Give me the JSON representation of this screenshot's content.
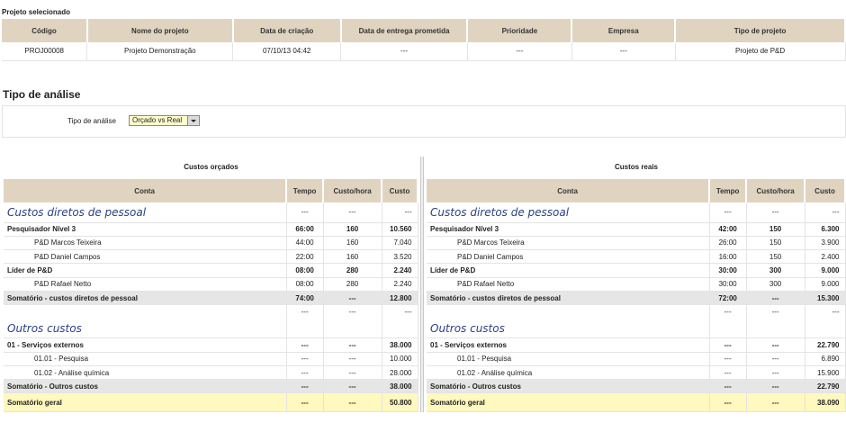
{
  "project": {
    "section_title": "Projeto selecionado",
    "headers": [
      "Código",
      "Nome do projeto",
      "Data de criação",
      "Data de entrega prometida",
      "Prioridade",
      "Empresa",
      "Tipo de projeto"
    ],
    "row": [
      "PROJ00008",
      "Projeto Demonstração",
      "07/10/13 04:42",
      "---",
      "---",
      "---",
      "Projeto de P&D"
    ]
  },
  "analysis": {
    "title": "Tipo de análise",
    "field_label": "Tipo de análise",
    "selected": "Orçado vs Real"
  },
  "budget": {
    "title": "Custos orçados",
    "headers": [
      "Conta",
      "Tempo",
      "Custo/hora",
      "Custo"
    ],
    "rows": [
      {
        "type": "cat",
        "cells": [
          "Custos diretos de pessoal",
          "---",
          "---",
          "---"
        ]
      },
      {
        "type": "bold",
        "cells": [
          "Pesquisador Nível 3",
          "66:00",
          "160",
          "10.560"
        ]
      },
      {
        "type": "child",
        "cells": [
          "P&D Marcos Teixeira",
          "44:00",
          "160",
          "7.040"
        ]
      },
      {
        "type": "child",
        "cells": [
          "P&D Daniel Campos",
          "22:00",
          "160",
          "3.520"
        ]
      },
      {
        "type": "bold",
        "cells": [
          "Líder de P&D",
          "08:00",
          "280",
          "2.240"
        ]
      },
      {
        "type": "child",
        "cells": [
          "P&D Rafael Netto",
          "08:00",
          "280",
          "2.240"
        ]
      },
      {
        "type": "subtotal",
        "cells": [
          "Somatório - custos diretos de pessoal",
          "74:00",
          "---",
          "12.800"
        ]
      },
      {
        "type": "gap",
        "cells": [
          "",
          "---",
          "---",
          "---"
        ]
      },
      {
        "type": "cat",
        "cells": [
          "Outros custos",
          "",
          "",
          ""
        ]
      },
      {
        "type": "bold",
        "cells": [
          "01 - Serviços externos",
          "---",
          "---",
          "38.000"
        ]
      },
      {
        "type": "child",
        "cells": [
          "01.01 - Pesquisa",
          "---",
          "---",
          "10.000"
        ]
      },
      {
        "type": "child",
        "cells": [
          "01.02 - Análise química",
          "---",
          "---",
          "28.000"
        ]
      },
      {
        "type": "subtotal",
        "cells": [
          "Somatório - Outros custos",
          "---",
          "---",
          "38.000"
        ]
      },
      {
        "type": "grand",
        "cells": [
          "Somatório geral",
          "---",
          "---",
          "50.800"
        ]
      }
    ]
  },
  "actual": {
    "title": "Custos reais",
    "headers": [
      "Conta",
      "Tempo",
      "Custo/hora",
      "Custo"
    ],
    "rows": [
      {
        "type": "cat",
        "cells": [
          "Custos diretos de pessoal",
          "---",
          "---",
          "---"
        ]
      },
      {
        "type": "bold",
        "cells": [
          "Pesquisador Nível 3",
          "42:00",
          "150",
          "6.300"
        ]
      },
      {
        "type": "child",
        "cells": [
          "P&D Marcos Teixeira",
          "26:00",
          "150",
          "3.900"
        ]
      },
      {
        "type": "child",
        "cells": [
          "P&D Daniel Campos",
          "16:00",
          "150",
          "2.400"
        ]
      },
      {
        "type": "bold",
        "cells": [
          "Líder de P&D",
          "30:00",
          "300",
          "9.000"
        ]
      },
      {
        "type": "child",
        "cells": [
          "P&D Rafael Netto",
          "30:00",
          "300",
          "9.000"
        ]
      },
      {
        "type": "subtotal",
        "cells": [
          "Somatório - custos diretos de pessoal",
          "72:00",
          "---",
          "15.300"
        ]
      },
      {
        "type": "gap",
        "cells": [
          "",
          "---",
          "---",
          "---"
        ]
      },
      {
        "type": "cat",
        "cells": [
          "Outros custos",
          "",
          "",
          ""
        ]
      },
      {
        "type": "bold",
        "cells": [
          "01 - Serviços externos",
          "---",
          "---",
          "22.790"
        ]
      },
      {
        "type": "child",
        "cells": [
          "01.01 - Pesquisa",
          "---",
          "---",
          "6.890"
        ]
      },
      {
        "type": "child",
        "cells": [
          "01.02 - Análise química",
          "---",
          "---",
          "15.900"
        ]
      },
      {
        "type": "subtotal",
        "cells": [
          "Somatório - Outros custos",
          "---",
          "---",
          "22.790"
        ]
      },
      {
        "type": "grand",
        "cells": [
          "Somatório geral",
          "---",
          "---",
          "38.090"
        ]
      }
    ]
  }
}
